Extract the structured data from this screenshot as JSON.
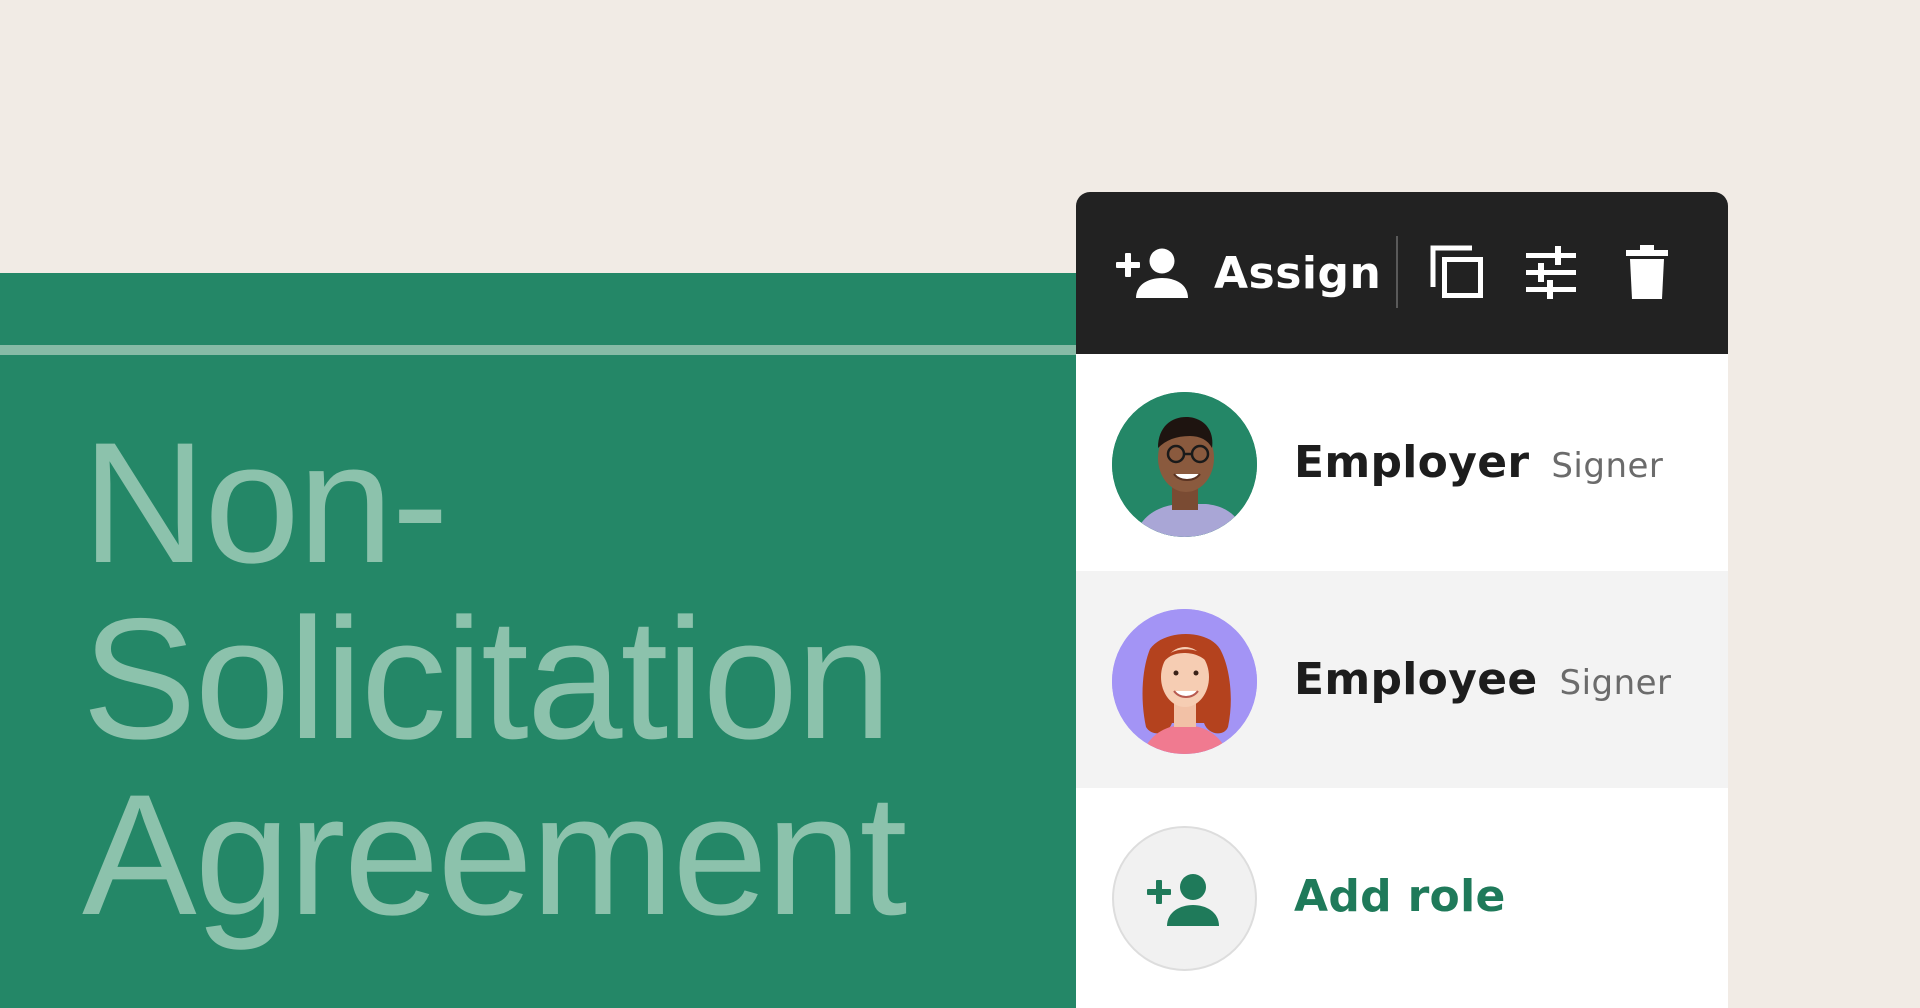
{
  "document": {
    "title_lines": [
      "Non-",
      "Solicitation",
      "Agreement"
    ]
  },
  "toolbar": {
    "assign_label": "Assign",
    "icons": [
      "add-person-icon",
      "copy-icon",
      "adjust-icon",
      "delete-icon"
    ]
  },
  "roles": [
    {
      "name": "Employer",
      "type": "Signer",
      "avatar_bg": "#248767"
    },
    {
      "name": "Employee",
      "type": "Signer",
      "avatar_bg": "#a394f5"
    }
  ],
  "add_role": {
    "label": "Add role"
  },
  "colors": {
    "page_background": "#f1ebe5",
    "document_green": "#248767",
    "title_text": "#8cc2ac",
    "toolbar_background": "#222222",
    "accent_green": "#1f7a5a",
    "selected_row": "#f3f3f3"
  }
}
